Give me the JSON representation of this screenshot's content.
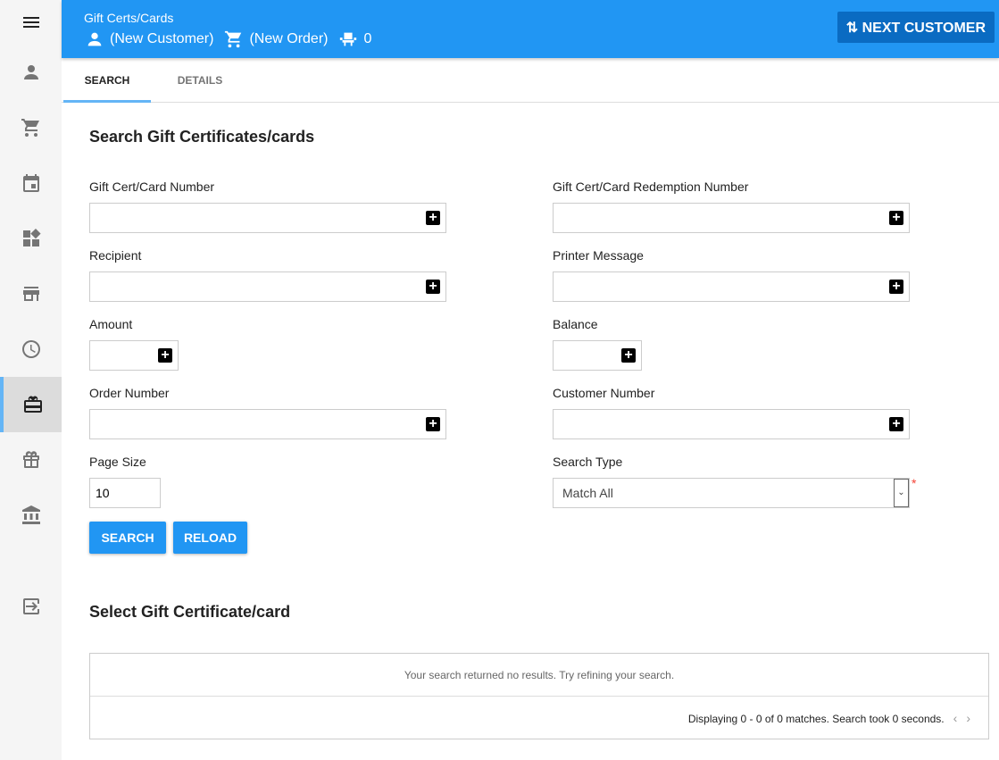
{
  "header": {
    "title": "Gift Certs/Cards",
    "customer": "(New Customer)",
    "order": "(New Order)",
    "seat_count": "0",
    "next_button": "NEXT CUSTOMER"
  },
  "sidebar": {
    "items": [
      "menu-icon",
      "person-icon",
      "cart-icon",
      "calendar-icon",
      "widgets-icon",
      "store-icon",
      "clock-icon",
      "gift-card-icon",
      "gift-icon",
      "bank-icon",
      "logout-icon"
    ],
    "active": "gift-card-icon"
  },
  "tabs": [
    {
      "label": "SEARCH",
      "active": true
    },
    {
      "label": "DETAILS",
      "active": false
    }
  ],
  "search": {
    "heading": "Search Gift Certificates/cards",
    "fields": {
      "card_number": {
        "label": "Gift Cert/Card Number",
        "value": ""
      },
      "redemption_number": {
        "label": "Gift Cert/Card Redemption Number",
        "value": ""
      },
      "recipient": {
        "label": "Recipient",
        "value": ""
      },
      "printer_message": {
        "label": "Printer Message",
        "value": ""
      },
      "amount": {
        "label": "Amount",
        "value": ""
      },
      "balance": {
        "label": "Balance",
        "value": ""
      },
      "order_number": {
        "label": "Order Number",
        "value": ""
      },
      "customer_number": {
        "label": "Customer Number",
        "value": ""
      },
      "page_size": {
        "label": "Page Size",
        "value": "10"
      },
      "search_type": {
        "label": "Search Type",
        "value": "Match All",
        "required": true
      }
    },
    "search_button": "SEARCH",
    "reload_button": "RELOAD"
  },
  "results": {
    "heading": "Select Gift Certificate/card",
    "empty_message": "Your search returned no results. Try refining your search.",
    "footer": "Displaying 0 - 0 of 0 matches. Search took 0 seconds."
  },
  "colors": {
    "primary": "#2196f3",
    "primary_dark": "#0a6bc2",
    "required": "#f44336"
  }
}
